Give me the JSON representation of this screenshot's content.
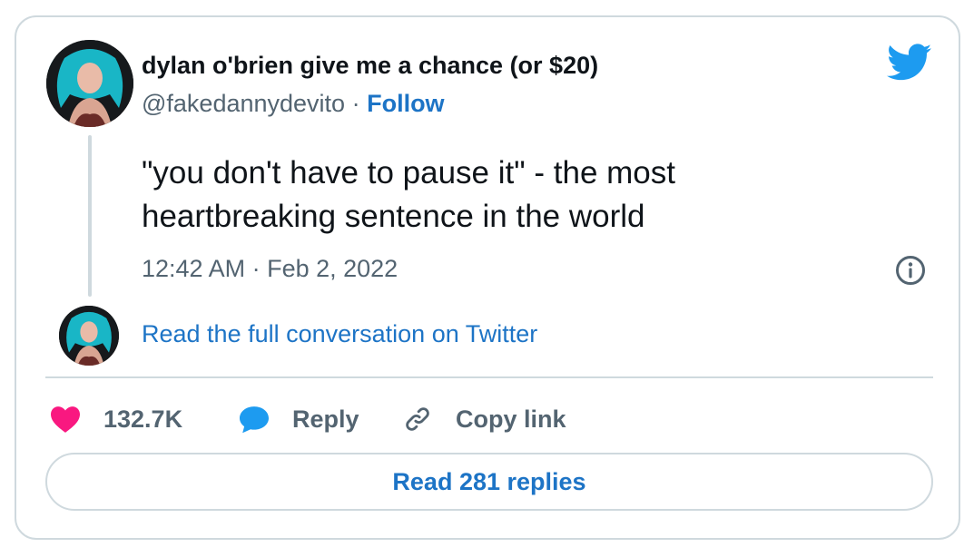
{
  "tweet": {
    "display_name": "dylan o'brien give me a chance (or $20)",
    "handle": "@fakedannydevito",
    "separator": "·",
    "follow_label": "Follow",
    "text": "\"you don't have to pause it\" - the most heartbreaking sentence in the world",
    "timestamp": "12:42 AM · Feb 2, 2022",
    "read_full_label": "Read the full conversation on Twitter"
  },
  "actions": {
    "like_count": "132.7K",
    "reply_label": "Reply",
    "copy_link_label": "Copy link",
    "read_replies_label": "Read 281 replies"
  },
  "colors": {
    "accent_link": "#1d74c6",
    "twitter_blue": "#1d9bf0",
    "like_pink": "#f91880",
    "muted_text": "#536471",
    "border": "#cfd9de"
  },
  "icons": [
    "twitter-bird-icon",
    "info-icon",
    "heart-icon",
    "reply-bubble-icon",
    "link-icon"
  ]
}
